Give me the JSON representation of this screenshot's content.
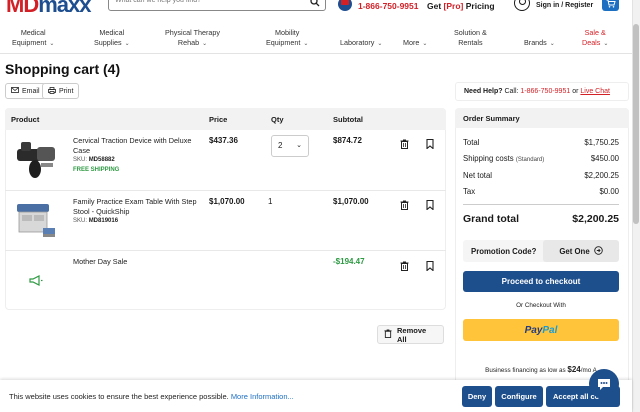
{
  "header": {
    "logo": "MDmaxx",
    "search_placeholder": "What can we help you find?",
    "phone": "1-866-750-9951",
    "pro_pricing_prefix": "Get ",
    "pro_pricing_pro": "[Pro]",
    "pro_pricing_suffix": " Pricing",
    "signin": "Sign in / Register"
  },
  "nav": [
    {
      "line1": "Medical",
      "line2": "Equipment"
    },
    {
      "line1": "Medical",
      "line2": "Supplies"
    },
    {
      "line1": "Physical Therapy",
      "line2": "Rehab"
    },
    {
      "line1": "Mobility",
      "line2": "Equipment"
    },
    {
      "line1": "Laboratory",
      "line2": ""
    },
    {
      "line1": "More",
      "line2": ""
    },
    {
      "line1": "Solution &",
      "line2": "Rentals"
    },
    {
      "line1": "Brands",
      "line2": ""
    },
    {
      "line1": "Sale &",
      "line2": "Deals"
    }
  ],
  "page": {
    "title": "Shopping cart (4)",
    "email": "Email",
    "print": "Print",
    "need_help": "Need Help?",
    "call_prefix": " Call: ",
    "call_number": "1-866-750-9951",
    "or": " or ",
    "live_chat": "Live Chat"
  },
  "cart": {
    "headers": {
      "product": "Product",
      "price": "Price",
      "qty": "Qty",
      "subtotal": "Subtotal"
    },
    "items": [
      {
        "name": "Cervical Traction Device with Deluxe Case",
        "sku_label": "SKU:",
        "sku": "MD58882",
        "shipping": "FREE SHIPPING",
        "price": "$437.36",
        "qty": "2",
        "subtotal": "$874.72"
      },
      {
        "name": "Family Practice Exam Table With Step Stool - QuickShip",
        "sku_label": "SKU:",
        "sku": "MD819016",
        "price": "$1,070.00",
        "qty": "1",
        "subtotal": "$1,070.00"
      },
      {
        "name": "Mother Day Sale",
        "subtotal": "-$194.47"
      }
    ],
    "remove_all": "Remove All"
  },
  "summary": {
    "heading": "Order Summary",
    "total_label": "Total",
    "total": "$1,750.25",
    "shipping_label": "Shipping costs",
    "shipping_note": "(Standard)",
    "shipping": "$450.00",
    "net_label": "Net total",
    "net": "$2,200.25",
    "tax_label": "Tax",
    "tax": "$0.00",
    "grand_label": "Grand total",
    "grand": "$2,200.25",
    "promo_label": "Promotion Code?",
    "get_one": "Get One",
    "checkout": "Proceed to checkout",
    "or_checkout": "Or Checkout With",
    "paypal_pay": "Pay",
    "paypal_pal": "Pal",
    "financing_prefix": "Business financing as low as ",
    "financing_amount": "$24",
    "financing_suffix": "/mo A"
  },
  "cookie": {
    "text": "This website uses cookies to ensure the best experience possible.",
    "more": "More Information...",
    "deny": "Deny",
    "configure": "Configure",
    "accept": "Accept all co"
  },
  "colors": {
    "brand_red": "#d32027",
    "brand_blue": "#1e4f8d",
    "green": "#2e9a43",
    "paypal_yellow": "#ffc439"
  }
}
